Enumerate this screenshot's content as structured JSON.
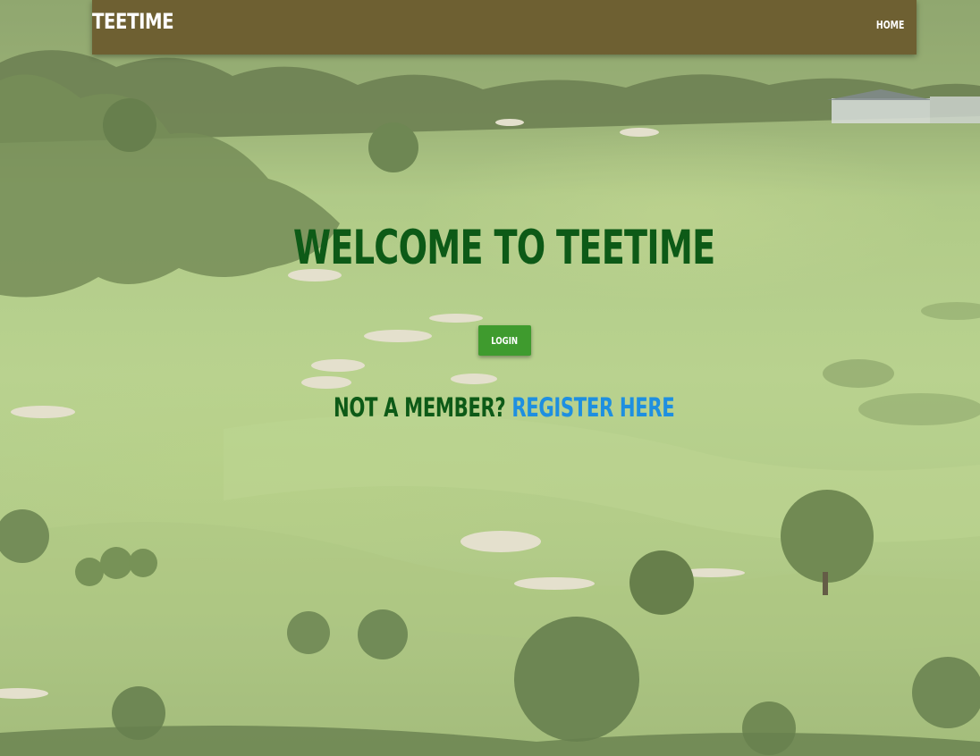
{
  "navbar": {
    "brand": "TEETIME",
    "home_label": "HOME",
    "background_color": "#6e6032"
  },
  "main": {
    "welcome_heading": "WELCOME TO TEETIME",
    "login_button_label": "LOGIN",
    "not_member_text": "NOT A MEMBER?",
    "register_link_text": "REGISTER HERE",
    "heading_color": "#0d5a17",
    "button_color": "#3f9b2e",
    "link_color": "#1e8fe0"
  }
}
